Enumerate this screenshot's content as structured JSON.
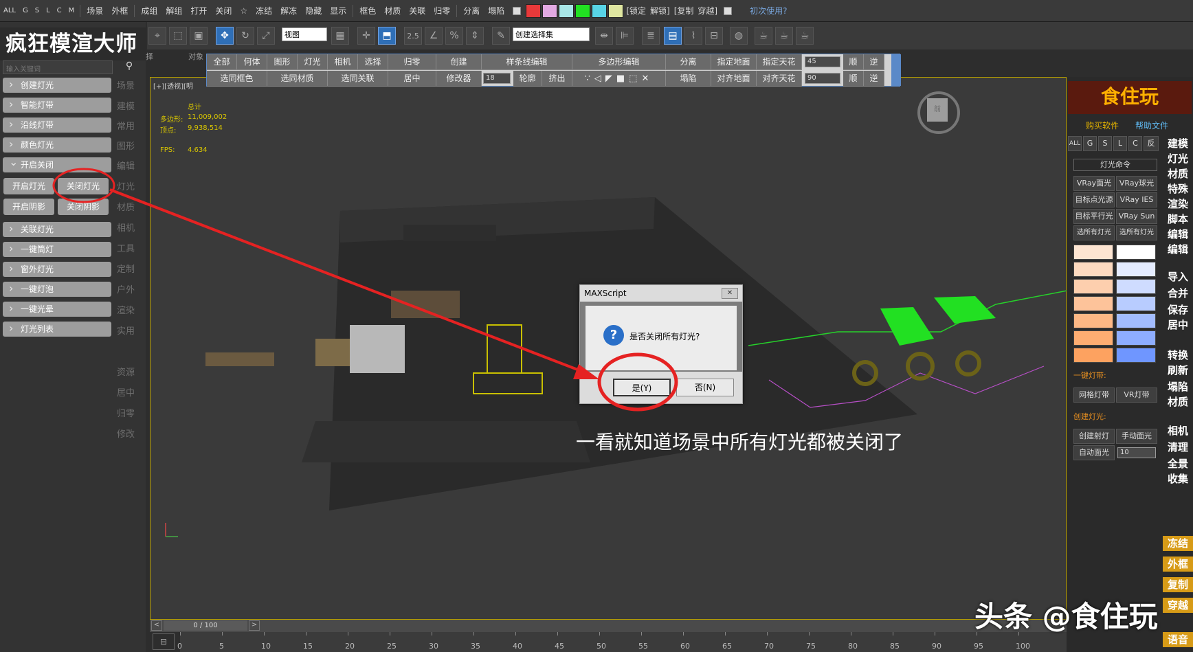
{
  "topbar": {
    "filters": [
      "ALL",
      "G",
      "S",
      "L",
      "C",
      "M"
    ],
    "menu": [
      "场景",
      "外框",
      "成组",
      "解组",
      "打开",
      "关闭",
      "☆",
      "冻结",
      "解冻",
      "隐藏",
      "显示",
      "框色",
      "材质",
      "关联",
      "归零",
      "分离",
      "塌陷"
    ],
    "colors": [
      "#e8393a",
      "#e2a9e2",
      "#a8e6e6",
      "#22e022",
      "#58d4e6",
      "#dfe6a0"
    ],
    "brackets": [
      "[锁定",
      "解锁]",
      "[复制",
      "穿越]"
    ],
    "help": "初次使用?"
  },
  "toolbar": {
    "view_select": "视图",
    "selection_set": "创建选择集",
    "snap_25": "2.5",
    "snap_pct": "%"
  },
  "left": {
    "brand": "疯狂模渲大师",
    "search_placeholder": "输入关键词",
    "items": [
      "创建灯光",
      "智能灯带",
      "沿线灯带",
      "颜色灯光",
      "开启关闭",
      "关联灯光",
      "一键筒灯",
      "窗外灯光",
      "一键灯泡",
      "一键光晕",
      "灯光列表"
    ],
    "sub": [
      "开启灯光",
      "关闭灯光",
      "开启阴影",
      "关闭阴影"
    ],
    "col": [
      "场景",
      "建模",
      "常用",
      "图形",
      "编辑",
      "灯光",
      "材质",
      "相机",
      "工具",
      "定制",
      "户外",
      "渲染",
      "实用",
      "资源",
      "居中",
      "归零",
      "修改"
    ],
    "tab_frag": [
      "择",
      "对象"
    ]
  },
  "popbar": {
    "row1": [
      "全部",
      "何体",
      "图形",
      "灯光",
      "相机",
      "选择",
      "归零",
      "创建",
      "样条线编辑",
      "多边形编辑",
      "分离",
      "指定地面",
      "指定天花",
      "45",
      "顺",
      "逆"
    ],
    "row2": [
      "选同框色",
      "选同材质",
      "选同关联",
      "居中",
      "修改器",
      "18",
      "轮廓",
      "挤出",
      "塌陷",
      "对齐地面",
      "对齐天花",
      "90",
      "顺",
      "逆"
    ]
  },
  "viewport": {
    "label": "[+][透视][明",
    "stats_head": "总计",
    "poly_label": "多边形:",
    "poly_value": "11,009,002",
    "vert_label": "顶点:",
    "vert_value": "9,938,514",
    "fps_label": "FPS:",
    "fps_value": "4.634",
    "cube": "前"
  },
  "right": {
    "logo": "食住玩",
    "links": [
      "购买软件",
      "帮助文件"
    ],
    "filters": [
      "ALL",
      "G",
      "S",
      "L",
      "C",
      "反"
    ],
    "group": "灯光命令",
    "lights": [
      "VRay面光",
      "VRay球光",
      "目标点光源",
      "VRay IES",
      "目标平行光",
      "VRay Sun",
      "选所有灯光",
      "选所有灯光"
    ],
    "swatch_left": [
      "#fde5d2",
      "#fddac0",
      "#fdcfae",
      "#fdc39a",
      "#fdb885",
      "#fdad72",
      "#fda260"
    ],
    "swatch_right": [
      "#ffffff",
      "#e5ecff",
      "#cfdcff",
      "#b8ccff",
      "#a2bcff",
      "#8eadff",
      "#6f96ff"
    ],
    "strip_label": "一键灯带:",
    "strip_btns": [
      "网格灯带",
      "VR灯带"
    ],
    "create_label": "创建灯光:",
    "create_btns": [
      "创建射灯",
      "手动面光",
      "自动面光"
    ],
    "create_value": "10",
    "cmds": [
      "建模",
      "灯光",
      "材质",
      "特殊",
      "渲染",
      "脚本",
      "编辑",
      "编辑",
      "导入",
      "合并",
      "保存",
      "居中",
      "转换",
      "刷新",
      "塌陷",
      "材质",
      "相机",
      "清理",
      "全景",
      "收集"
    ],
    "gold_cmds": [
      "冻结",
      "外框",
      "复制",
      "穿越",
      "语音"
    ]
  },
  "dialog": {
    "title": "MAXScript",
    "close": "✕",
    "icon": "?",
    "message": "是否关闭所有灯光?",
    "yes": "是(Y)",
    "no": "否(N)"
  },
  "timeline": {
    "frame": "0 / 100",
    "prev": "<",
    "next": ">",
    "ticks": [
      "0",
      "5",
      "10",
      "15",
      "20",
      "25",
      "30",
      "35",
      "40",
      "45",
      "50",
      "55",
      "60",
      "65",
      "70",
      "75",
      "80",
      "85",
      "90",
      "95",
      "100"
    ]
  },
  "caption": "一看就知道场景中所有灯光都被关闭了",
  "watermark": "头条 @食住玩"
}
